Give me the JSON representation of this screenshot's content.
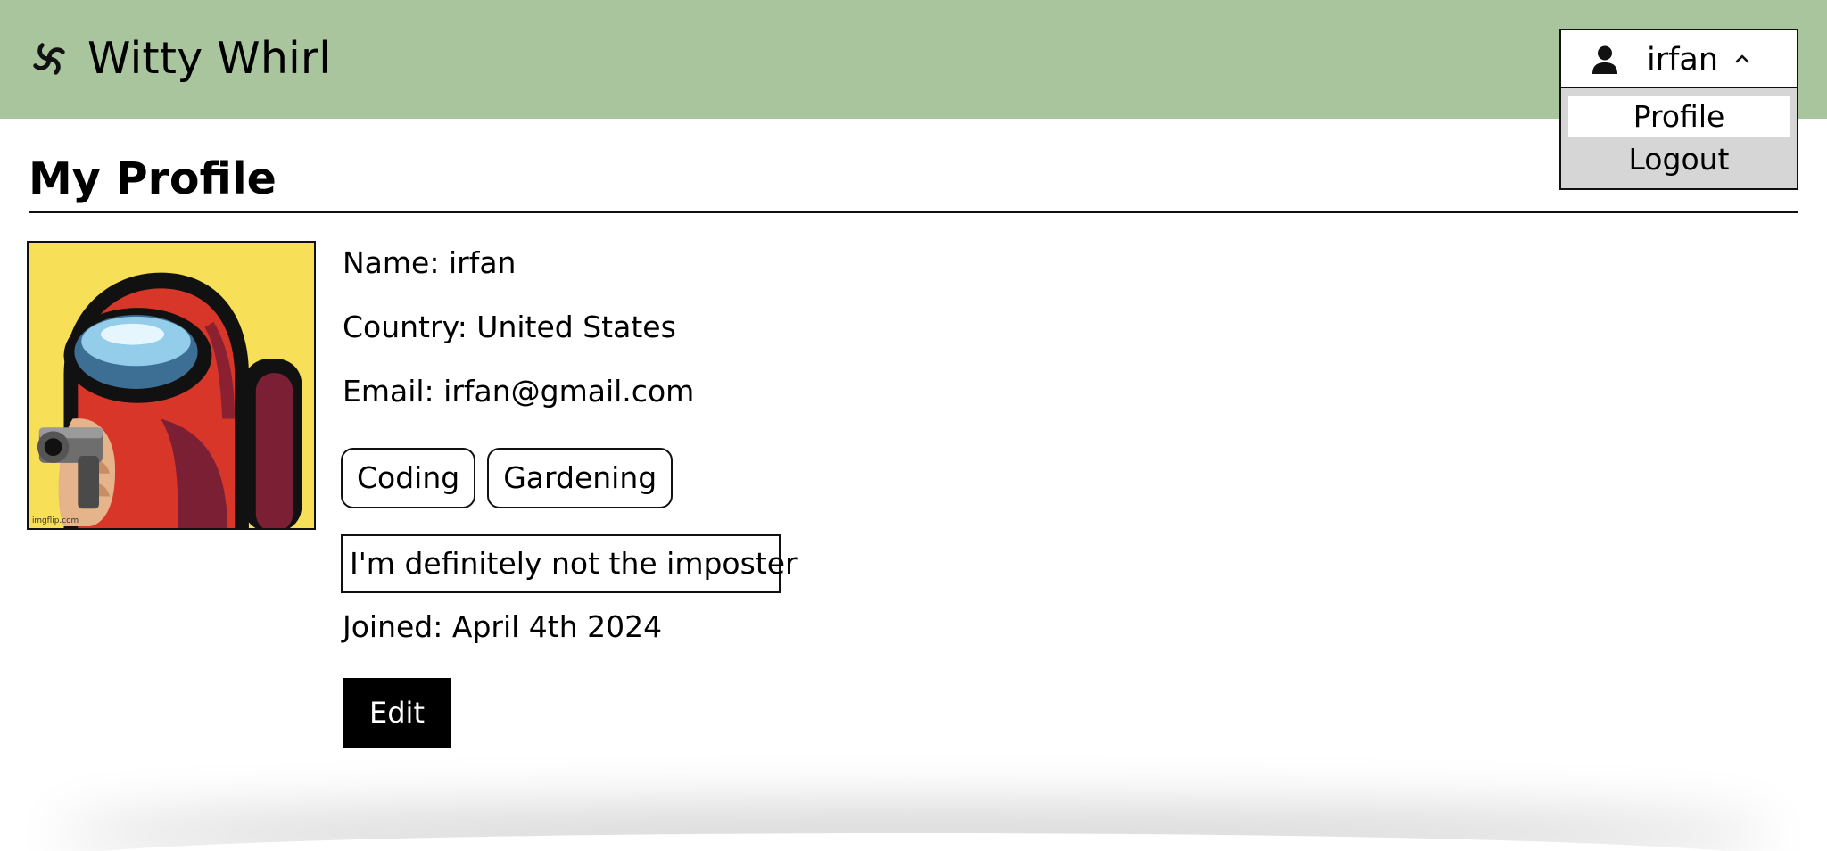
{
  "header": {
    "app_name": "Witty Whirl",
    "logo_icon": "swirl-icon",
    "background": "#a8c59d"
  },
  "user_menu": {
    "username": "irfan",
    "user_icon": "user-icon",
    "toggle_icon": "chevron-up-icon",
    "expanded": true,
    "items": [
      {
        "label": "Profile",
        "selected": true
      },
      {
        "label": "Logout",
        "selected": false
      }
    ]
  },
  "main": {
    "title": "My Profile",
    "name_line": "Name: irfan",
    "country_line": "Country: United States",
    "email_line": "Email: irfan@gmail.com",
    "tags": [
      "Coding",
      "Gardening"
    ],
    "bio": "I'm definitely not the imposter",
    "joined_line": "Joined: April 4th 2024",
    "edit_label": "Edit",
    "avatar_watermark": "imgflip.com"
  }
}
